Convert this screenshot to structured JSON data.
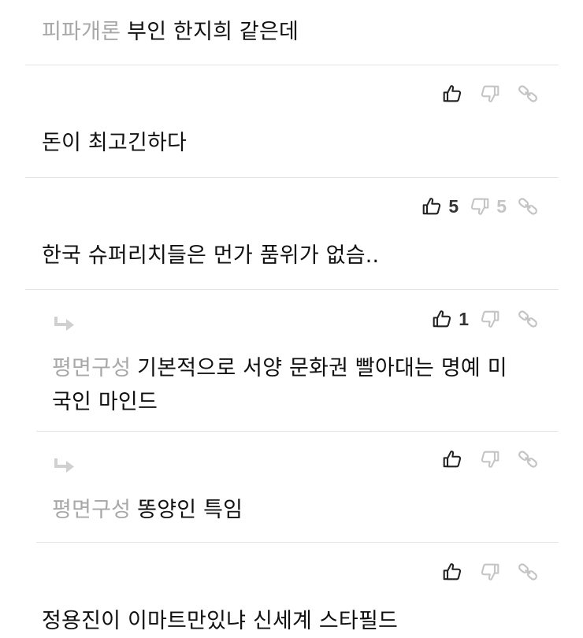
{
  "comments": [
    {
      "author": "피파개론",
      "text": "부인 한지희 같은데",
      "likes": "",
      "dislikes": ""
    },
    {
      "author": "",
      "text": "돈이 최고긴하다",
      "likes": "",
      "dislikes": ""
    },
    {
      "author": "",
      "text": "한국 슈퍼리치들은 먼가 품위가 없슴..",
      "likes": "5",
      "dislikes": "5"
    },
    {
      "author": "평면구성",
      "text": "기본적으로 서양 문화권 빨아대는 명예 미국인 마인드",
      "likes": "1",
      "dislikes": "",
      "is_reply": true
    },
    {
      "author": "평면구성",
      "text": "똥양인 특임",
      "likes": "",
      "dislikes": "",
      "is_reply": true
    },
    {
      "author": "",
      "text": "정용진이 이마트만있냐 신세계 스타필드",
      "likes": "",
      "dislikes": ""
    }
  ],
  "icons": {
    "like": "thumbs-up-icon",
    "dislike": "thumbs-down-icon",
    "link": "link-icon",
    "reply_indicator": "reply-arrow-icon"
  },
  "colors": {
    "author": "#a8a8a8",
    "text": "#111111",
    "like_icon": "#222222",
    "dislike_icon": "#c4c4c4",
    "divider": "#e4e4e4"
  }
}
